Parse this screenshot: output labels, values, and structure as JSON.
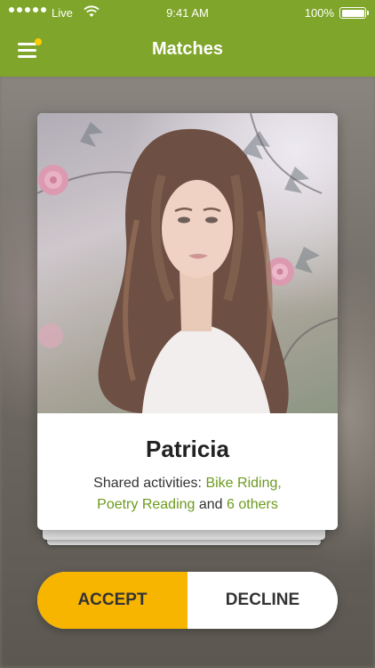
{
  "status_bar": {
    "carrier": "Live",
    "time": "9:41 AM",
    "battery": "100%"
  },
  "nav": {
    "title": "Matches",
    "menu_icon": "hamburger-menu-icon",
    "has_notification": true
  },
  "match": {
    "name": "Patricia",
    "shared_prefix": "Shared activities: ",
    "activity_1": "Bike Riding",
    "separator": ",",
    "activity_2": "Poetry Reading",
    "conjunction": " and ",
    "others": "6 others"
  },
  "actions": {
    "accept_label": "ACCEPT",
    "decline_label": "DECLINE"
  },
  "colors": {
    "header": "#7fa52a",
    "accept": "#f7b500",
    "activity_link": "#6d9a1f",
    "notification_dot": "#ffcc00"
  }
}
